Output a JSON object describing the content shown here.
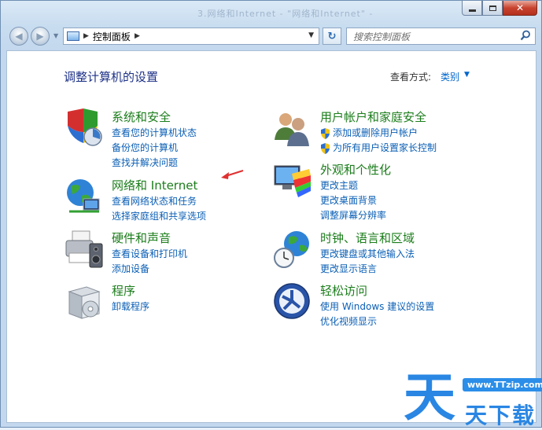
{
  "window": {
    "title": "3.网络和Internet - \"网络和Internet\" -"
  },
  "nav": {
    "back_glyph": "◀",
    "forward_glyph": "▶",
    "recent_glyph": "▼",
    "address_sep": "▶",
    "address_text": "控制面板",
    "address_tail": "▶",
    "address_drop": "▼",
    "refresh_glyph": "↻",
    "search_placeholder": "搜索控制面板"
  },
  "header": {
    "title": "调整计算机的设置",
    "view_by_label": "查看方式:",
    "view_by_value": "类别",
    "view_by_arrow": "▼"
  },
  "categories": [
    {
      "title": "系统和安全",
      "links": [
        "查看您的计算机状态",
        "备份您的计算机",
        "查找并解决问题"
      ]
    },
    {
      "title": "网络和 Internet",
      "links": [
        "查看网络状态和任务",
        "选择家庭组和共享选项"
      ]
    },
    {
      "title": "硬件和声音",
      "links": [
        "查看设备和打印机",
        "添加设备"
      ]
    },
    {
      "title": "程序",
      "links": [
        "卸载程序"
      ]
    },
    {
      "title": "用户帐户和家庭安全",
      "links": [
        "添加或删除用户帐户",
        "为所有用户设置家长控制"
      ]
    },
    {
      "title": "外观和个性化",
      "links": [
        "更改主题",
        "更改桌面背景",
        "调整屏幕分辨率"
      ]
    },
    {
      "title": "时钟、语言和区域",
      "links": [
        "更改键盘或其他输入法",
        "更改显示语言"
      ]
    },
    {
      "title": "轻松访问",
      "links": [
        "使用 Windows 建议的设置",
        "优化视频显示"
      ]
    }
  ],
  "watermark": {
    "url": "www.TTzip.com",
    "big": "天",
    "small": "天下载"
  },
  "colors": {
    "category_title": "#1b7d1b",
    "link": "#0b5fb5",
    "page_title": "#1e3287",
    "annotation_arrow": "#e03030"
  }
}
